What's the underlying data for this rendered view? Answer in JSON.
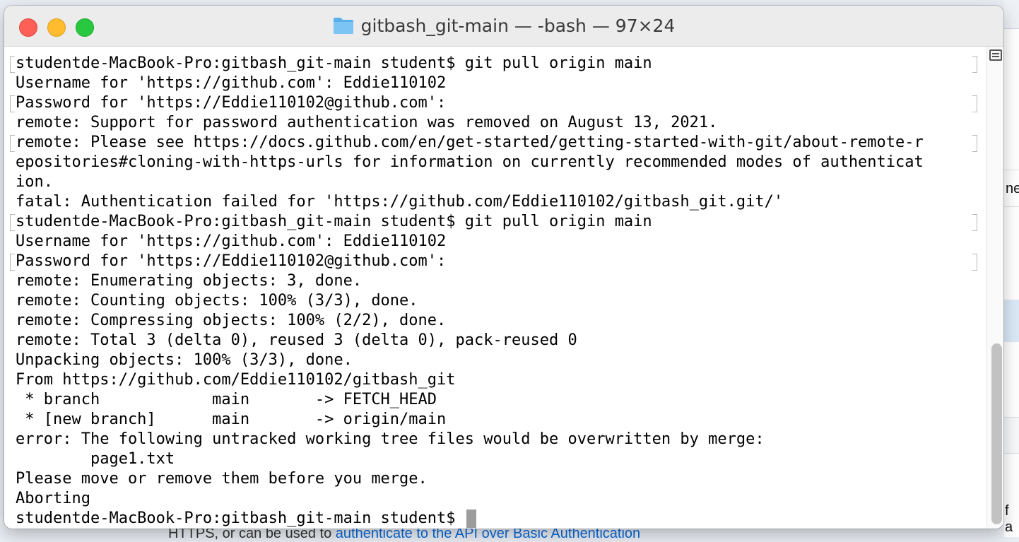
{
  "window": {
    "title": "gitbash_git-main — -bash — 97×24"
  },
  "terminal": {
    "lines": [
      "studentde-MacBook-Pro:gitbash_git-main student$ git pull origin main",
      "Username for 'https://github.com': Eddie110102",
      "Password for 'https://Eddie110102@github.com':",
      "remote: Support for password authentication was removed on August 13, 2021.",
      "remote: Please see https://docs.github.com/en/get-started/getting-started-with-git/about-remote-r",
      "epositories#cloning-with-https-urls for information on currently recommended modes of authenticat",
      "ion.",
      "fatal: Authentication failed for 'https://github.com/Eddie110102/gitbash_git.git/'",
      "studentde-MacBook-Pro:gitbash_git-main student$ git pull origin main",
      "Username for 'https://github.com': Eddie110102",
      "Password for 'https://Eddie110102@github.com':",
      "remote: Enumerating objects: 3, done.",
      "remote: Counting objects: 100% (3/3), done.",
      "remote: Compressing objects: 100% (2/2), done.",
      "remote: Total 3 (delta 0), reused 3 (delta 0), pack-reused 0",
      "Unpacking objects: 100% (3/3), done.",
      "From https://github.com/Eddie110102/gitbash_git",
      " * branch            main       -> FETCH_HEAD",
      " * [new branch]      main       -> origin/main",
      "error: The following untracked working tree files would be overwritten by merge:",
      "        page1.txt",
      "Please move or remove them before you merge.",
      "Aborting",
      "studentde-MacBook-Pro:gitbash_git-main student$ "
    ]
  },
  "background": {
    "right_text_1": "ne",
    "right_text_2": "f a",
    "bottom_text_prefix": "HTTPS, or can be used to ",
    "bottom_link": "authenticate to the API over Basic Authentication"
  },
  "colors": {
    "close": "#fe5f57",
    "minimize": "#febc2e",
    "maximize": "#28c840",
    "cursor": "#9c9c9c",
    "link": "#0969da"
  },
  "icons": {
    "title": "folder-icon",
    "scrollbar": "split-pane-icon"
  }
}
